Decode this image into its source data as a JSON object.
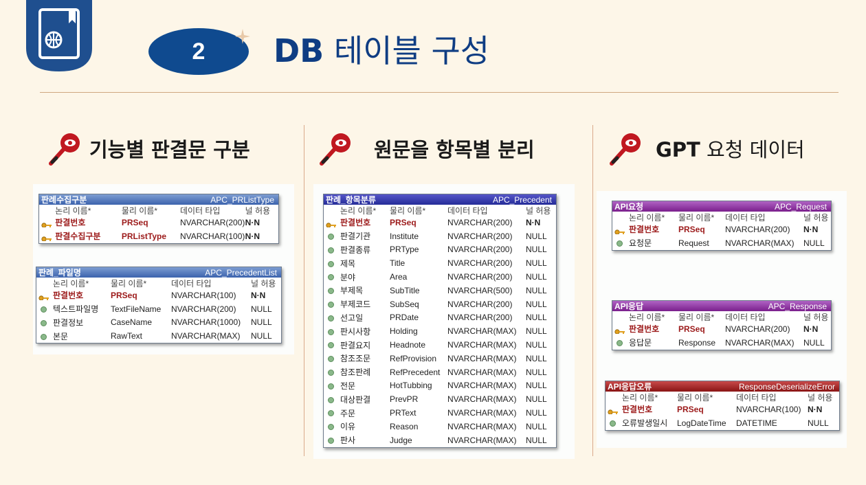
{
  "slide": {
    "number": "2",
    "title_bold": "DB",
    "title_rest": " 테이블 구성"
  },
  "sections": [
    {
      "title": "기능별 판결문 구분"
    },
    {
      "title": "원문을 항목별 분리"
    },
    {
      "title_bold": "GPT",
      "title_rest": " 요청 데이터"
    }
  ],
  "columns": [
    "논리 이름*",
    "물리 이름*",
    "데이터 타입",
    "널 허용"
  ],
  "tables": {
    "prlisttype": {
      "logical": "판례수집구분",
      "physical": "APC_PRListType",
      "rows": [
        {
          "key": true,
          "logical": "판결번호",
          "physical": "PRSeq",
          "type": "NVARCHAR(200)",
          "null": "N·N"
        },
        {
          "key": true,
          "logical": "판결수집구분",
          "physical": "PRListType",
          "type": "NVARCHAR(100)",
          "null": "N·N"
        }
      ]
    },
    "precedentlist": {
      "logical": "판례_파일명",
      "physical": "APC_PrecedentList",
      "rows": [
        {
          "key": true,
          "logical": "판결번호",
          "physical": "PRSeq",
          "type": "NVARCHAR(100)",
          "null": "N·N"
        },
        {
          "key": false,
          "logical": "텍스트파일명",
          "physical": "TextFileName",
          "type": "NVARCHAR(200)",
          "null": "NULL"
        },
        {
          "key": false,
          "logical": "판결정보",
          "physical": "CaseName",
          "type": "NVARCHAR(1000)",
          "null": "NULL"
        },
        {
          "key": false,
          "logical": "본문",
          "physical": "RawText",
          "type": "NVARCHAR(MAX)",
          "null": "NULL"
        }
      ]
    },
    "precedent": {
      "logical": "판례_항목분류",
      "physical": "APC_Precedent",
      "rows": [
        {
          "key": true,
          "logical": "판결번호",
          "physical": "PRSeq",
          "type": "NVARCHAR(200)",
          "null": "N·N"
        },
        {
          "key": false,
          "logical": "판결기관",
          "physical": "Institute",
          "type": "NVARCHAR(200)",
          "null": "NULL"
        },
        {
          "key": false,
          "logical": "판결종류",
          "physical": "PRType",
          "type": "NVARCHAR(200)",
          "null": "NULL"
        },
        {
          "key": false,
          "logical": "제목",
          "physical": "Title",
          "type": "NVARCHAR(200)",
          "null": "NULL"
        },
        {
          "key": false,
          "logical": "분야",
          "physical": "Area",
          "type": "NVARCHAR(200)",
          "null": "NULL"
        },
        {
          "key": false,
          "logical": "부제목",
          "physical": "SubTitle",
          "type": "NVARCHAR(500)",
          "null": "NULL"
        },
        {
          "key": false,
          "logical": "부제코드",
          "physical": "SubSeq",
          "type": "NVARCHAR(200)",
          "null": "NULL"
        },
        {
          "key": false,
          "logical": "선고일",
          "physical": "PRDate",
          "type": "NVARCHAR(200)",
          "null": "NULL"
        },
        {
          "key": false,
          "logical": "판시사항",
          "physical": "Holding",
          "type": "NVARCHAR(MAX)",
          "null": "NULL"
        },
        {
          "key": false,
          "logical": "판결요지",
          "physical": "Headnote",
          "type": "NVARCHAR(MAX)",
          "null": "NULL"
        },
        {
          "key": false,
          "logical": "참조조문",
          "physical": "RefProvision",
          "type": "NVARCHAR(MAX)",
          "null": "NULL"
        },
        {
          "key": false,
          "logical": "참조판례",
          "physical": "RefPrecedent",
          "type": "NVARCHAR(MAX)",
          "null": "NULL"
        },
        {
          "key": false,
          "logical": "전문",
          "physical": "HotTubbing",
          "type": "NVARCHAR(MAX)",
          "null": "NULL"
        },
        {
          "key": false,
          "logical": "대상판결",
          "physical": "PrevPR",
          "type": "NVARCHAR(MAX)",
          "null": "NULL"
        },
        {
          "key": false,
          "logical": "주문",
          "physical": "PRText",
          "type": "NVARCHAR(MAX)",
          "null": "NULL"
        },
        {
          "key": false,
          "logical": "이유",
          "physical": "Reason",
          "type": "NVARCHAR(MAX)",
          "null": "NULL"
        },
        {
          "key": false,
          "logical": "판사",
          "physical": "Judge",
          "type": "NVARCHAR(MAX)",
          "null": "NULL"
        }
      ]
    },
    "request": {
      "logical": "API요청",
      "physical": "APC_Request",
      "rows": [
        {
          "key": true,
          "logical": "판결번호",
          "physical": "PRSeq",
          "type": "NVARCHAR(200)",
          "null": "N·N"
        },
        {
          "key": false,
          "logical": "요청문",
          "physical": "Request",
          "type": "NVARCHAR(MAX)",
          "null": "NULL"
        }
      ]
    },
    "response": {
      "logical": "API응답",
      "physical": "APC_Response",
      "rows": [
        {
          "key": true,
          "logical": "판결번호",
          "physical": "PRSeq",
          "type": "NVARCHAR(200)",
          "null": "N·N"
        },
        {
          "key": false,
          "logical": "응답문",
          "physical": "Response",
          "type": "NVARCHAR(MAX)",
          "null": "NULL"
        }
      ]
    },
    "error": {
      "logical": "API응답오류",
      "physical": "ResponseDeserializeError",
      "rows": [
        {
          "key": true,
          "logical": "판결번호",
          "physical": "PRSeq",
          "type": "NVARCHAR(100)",
          "null": "N·N"
        },
        {
          "key": false,
          "logical": "오류발생일시",
          "physical": "LogDateTime",
          "type": "DATETIME",
          "null": "NULL"
        }
      ]
    }
  },
  "colors": {
    "brand_navy": "#0f3d83",
    "background": "#fdf6e8",
    "key_red": "#9c1a1a"
  }
}
